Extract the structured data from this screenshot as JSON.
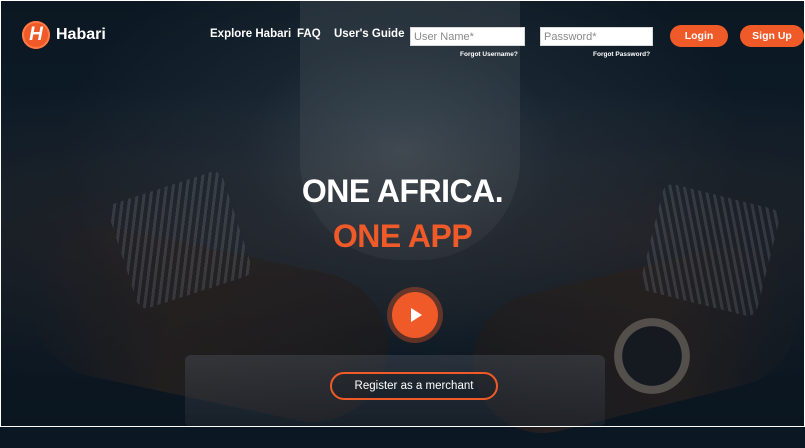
{
  "brand": {
    "name": "Habari",
    "logo_letter": "H",
    "accent_color": "#f05a28"
  },
  "nav": {
    "links": [
      "Explore Habari",
      "FAQ",
      "User's Guide"
    ]
  },
  "auth": {
    "username_placeholder": "User Name*",
    "password_placeholder": "Password*",
    "forgot_username": "Forgot Username?",
    "forgot_password": "Forgot Password?",
    "login_label": "Login",
    "signup_label": "Sign Up"
  },
  "hero": {
    "headline": "ONE AFRICA.",
    "subline": "ONE APP",
    "play_icon": "play-icon",
    "register_label": "Register as a merchant"
  }
}
